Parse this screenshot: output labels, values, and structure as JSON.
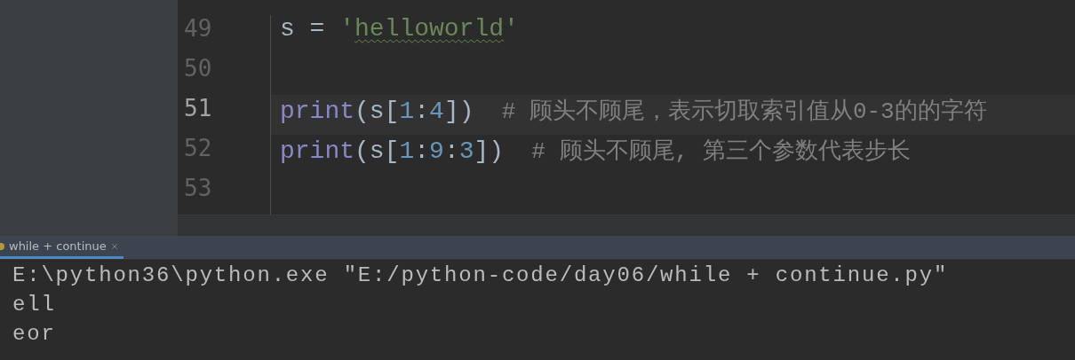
{
  "editor": {
    "lines": [
      {
        "number": "49",
        "current": false,
        "tokens": [
          {
            "kind": "plain",
            "text": "s = "
          },
          {
            "kind": "string",
            "text": "'"
          },
          {
            "kind": "string",
            "text": "helloworld",
            "typo": true
          },
          {
            "kind": "string",
            "text": "'"
          }
        ]
      },
      {
        "number": "50",
        "current": false
      },
      {
        "number": "51",
        "current": true,
        "tokens": [
          {
            "kind": "builtin",
            "text": "print"
          },
          {
            "kind": "plain",
            "text": "(s["
          },
          {
            "kind": "number",
            "text": "1"
          },
          {
            "kind": "plain",
            "text": ":"
          },
          {
            "kind": "number",
            "text": "4"
          },
          {
            "kind": "plain",
            "text": "])"
          },
          {
            "kind": "comment",
            "text": "  # 顾头不顾尾，表示切取索引值从0-3的的字符"
          }
        ]
      },
      {
        "number": "52",
        "current": false,
        "tokens": [
          {
            "kind": "builtin",
            "text": "print"
          },
          {
            "kind": "plain",
            "text": "(s["
          },
          {
            "kind": "number",
            "text": "1"
          },
          {
            "kind": "plain",
            "text": ":"
          },
          {
            "kind": "number",
            "text": "9"
          },
          {
            "kind": "plain",
            "text": ":"
          },
          {
            "kind": "number",
            "text": "3"
          },
          {
            "kind": "plain",
            "text": "])"
          },
          {
            "kind": "comment",
            "text": "  # 顾头不顾尾, 第三个参数代表步长"
          }
        ]
      },
      {
        "number": "53",
        "current": false
      }
    ]
  },
  "run_panel": {
    "tabs": [
      {
        "label": "while + continue",
        "selected": true
      }
    ],
    "output": [
      "E:\\python36\\python.exe \"E:/python-code/day06/while + continue.py\"",
      "ell",
      "eor"
    ]
  }
}
